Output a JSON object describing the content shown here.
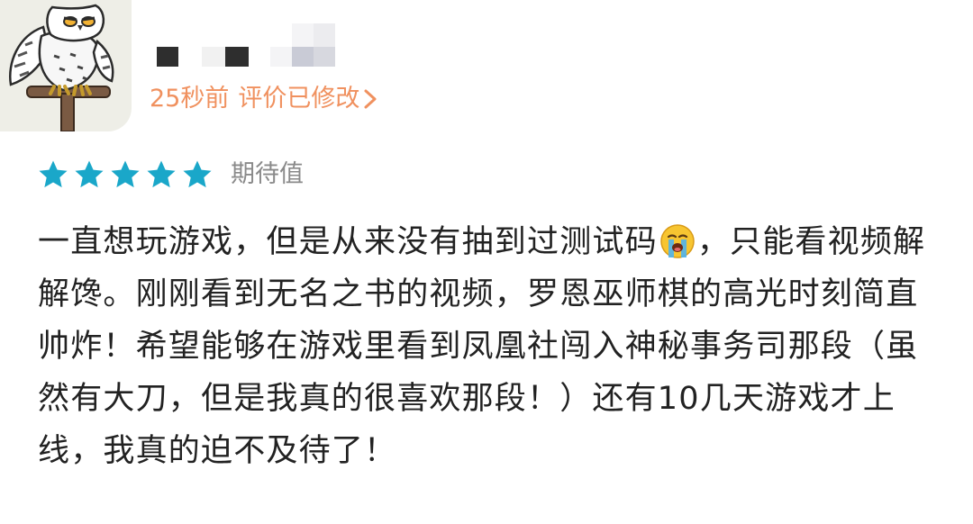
{
  "user": {
    "avatar_icon": "owl-avatar-icon",
    "name_redacted": true
  },
  "meta": {
    "time": "25秒前",
    "edited_label": "评价已修改",
    "edited_icon": "chevron-right-icon",
    "accent_color": "#f0915f"
  },
  "rating": {
    "stars": 5,
    "max_stars": 5,
    "star_color": "#1aa7c9",
    "label": "期待值"
  },
  "review": {
    "text_before_emoji": "一直想玩游戏，但是从来没有抽到过测试码",
    "emoji": "loudly-crying-face-icon",
    "text_after_emoji": "，只能看视频解解馋。刚刚看到无名之书的视频，罗恩巫师棋的高光时刻简直帅炸！希望能够在游戏里看到凤凰社闯入神秘事务司那段（虽然有大刀，但是我真的很喜欢那段！）还有10几天游戏才上线，我真的迫不及待了！"
  }
}
